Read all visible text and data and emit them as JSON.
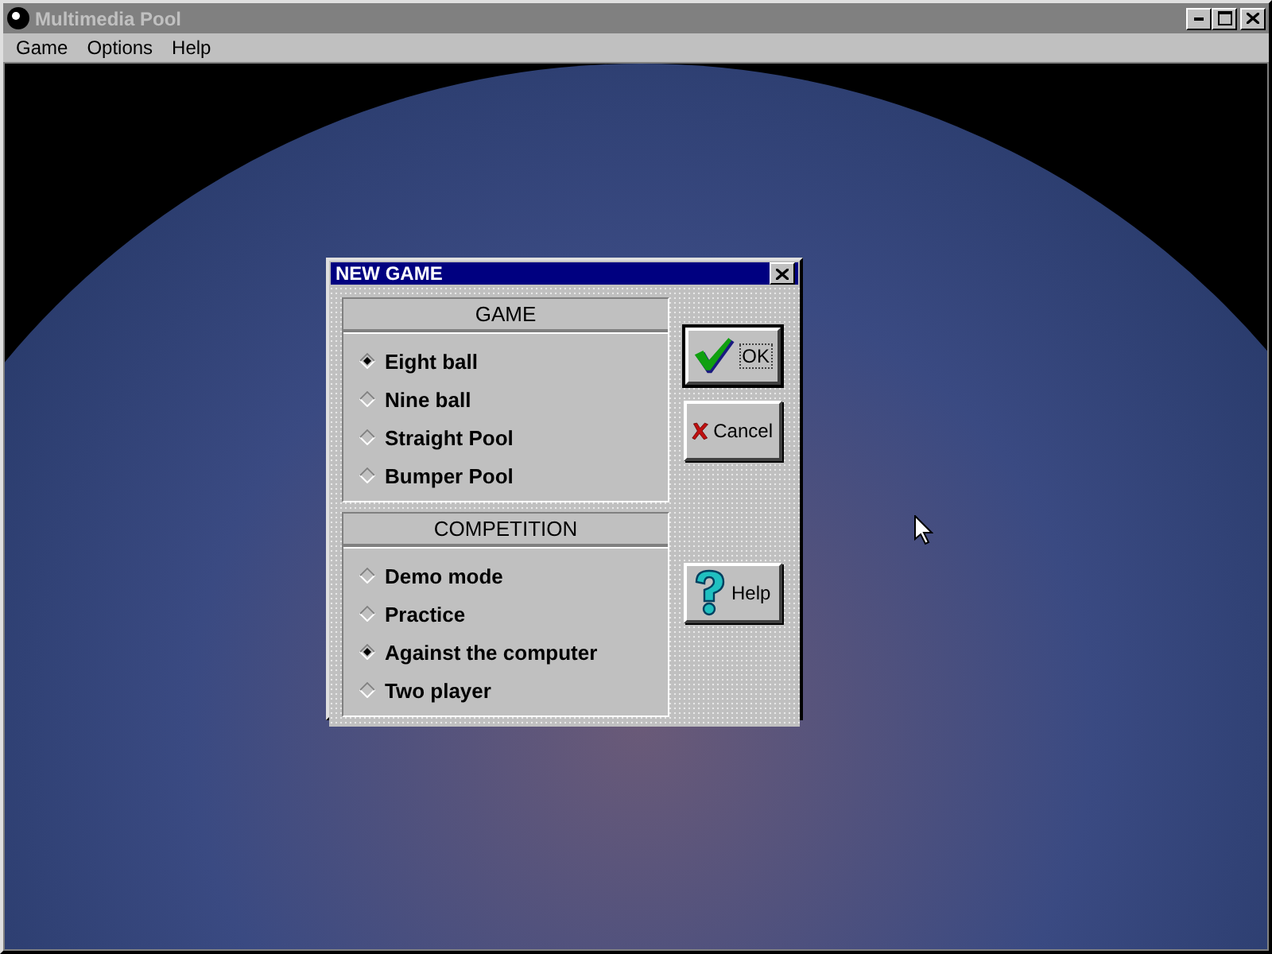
{
  "window": {
    "title": "Multimedia Pool"
  },
  "menu": [
    {
      "label": "Game"
    },
    {
      "label": "Options"
    },
    {
      "label": "Help"
    }
  ],
  "dialog": {
    "title": "NEW GAME",
    "groups": [
      {
        "heading": "GAME",
        "options": [
          {
            "label": "Eight ball",
            "selected": true
          },
          {
            "label": "Nine ball",
            "selected": false
          },
          {
            "label": "Straight Pool",
            "selected": false
          },
          {
            "label": "Bumper Pool",
            "selected": false
          }
        ]
      },
      {
        "heading": "COMPETITION",
        "options": [
          {
            "label": "Demo mode",
            "selected": false
          },
          {
            "label": "Practice",
            "selected": false
          },
          {
            "label": "Against the computer",
            "selected": true
          },
          {
            "label": "Two player",
            "selected": false
          }
        ]
      }
    ],
    "buttons": [
      {
        "label": "OK",
        "kind": "ok",
        "default": true
      },
      {
        "label": "Cancel",
        "kind": "cancel",
        "default": false
      },
      {
        "label": "Help",
        "kind": "help",
        "default": false
      }
    ]
  }
}
